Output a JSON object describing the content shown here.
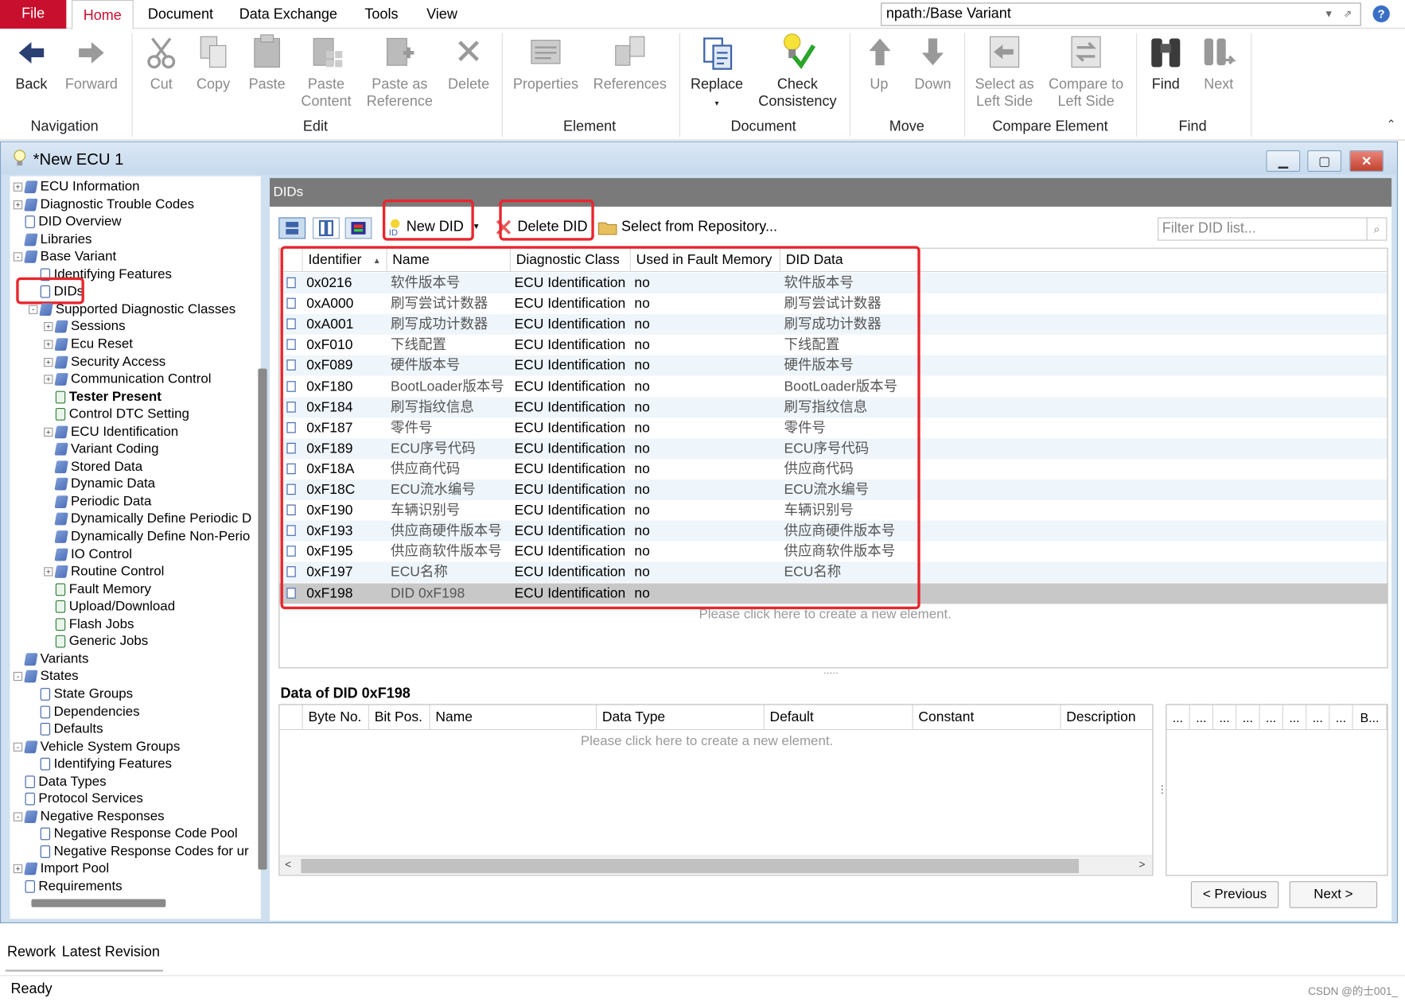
{
  "menu": {
    "file": "File",
    "tabs": [
      "Home",
      "Document",
      "Data Exchange",
      "Tools",
      "View"
    ],
    "npath": "npath:/Base Variant"
  },
  "ribbon": {
    "back": "Back",
    "forward": "Forward",
    "navigation": "Navigation",
    "cut": "Cut",
    "copy": "Copy",
    "paste": "Paste",
    "paste_content": [
      "Paste",
      "Content"
    ],
    "paste_reference": [
      "Paste as",
      "Reference"
    ],
    "delete": "Delete",
    "edit": "Edit",
    "properties": "Properties",
    "references": "References",
    "element": "Element",
    "replace": "Replace",
    "check_consistency": [
      "Check",
      "Consistency"
    ],
    "document": "Document",
    "up": "Up",
    "down": "Down",
    "move": "Move",
    "select_left": [
      "Select as",
      "Left Side"
    ],
    "compare_left": [
      "Compare to",
      "Left Side"
    ],
    "compare_element": "Compare Element",
    "find": "Find",
    "next": "Next",
    "find_group": "Find"
  },
  "doc": {
    "title": "*New ECU 1"
  },
  "tree": [
    {
      "label": "ECU Information",
      "level": 0,
      "exp": "+",
      "icon": "folder"
    },
    {
      "label": "Diagnostic Trouble Codes",
      "level": 0,
      "exp": "+",
      "icon": "folder"
    },
    {
      "label": "DID Overview",
      "level": 0,
      "exp": "",
      "icon": "page"
    },
    {
      "label": "Libraries",
      "level": 0,
      "exp": "",
      "icon": "folder"
    },
    {
      "label": "Base Variant",
      "level": 0,
      "exp": "-",
      "icon": "folder"
    },
    {
      "label": "Identifying Features",
      "level": 1,
      "exp": "",
      "icon": "page"
    },
    {
      "label": "DIDs",
      "level": 1,
      "exp": "",
      "icon": "page"
    },
    {
      "label": "Supported Diagnostic Classes",
      "level": 1,
      "exp": "-",
      "icon": "folder"
    },
    {
      "label": "Sessions",
      "level": 2,
      "exp": "+",
      "icon": "folder"
    },
    {
      "label": "Ecu Reset",
      "level": 2,
      "exp": "+",
      "icon": "folder"
    },
    {
      "label": "Security Access",
      "level": 2,
      "exp": "+",
      "icon": "folder"
    },
    {
      "label": "Communication Control",
      "level": 2,
      "exp": "+",
      "icon": "folder"
    },
    {
      "label": "Tester Present",
      "level": 2,
      "exp": "",
      "icon": "pageg",
      "bold": true
    },
    {
      "label": "Control DTC Setting",
      "level": 2,
      "exp": "",
      "icon": "pageg"
    },
    {
      "label": "ECU Identification",
      "level": 2,
      "exp": "+",
      "icon": "folder"
    },
    {
      "label": "Variant Coding",
      "level": 2,
      "exp": "",
      "icon": "folder"
    },
    {
      "label": "Stored Data",
      "level": 2,
      "exp": "",
      "icon": "folder"
    },
    {
      "label": "Dynamic Data",
      "level": 2,
      "exp": "",
      "icon": "folder"
    },
    {
      "label": "Periodic Data",
      "level": 2,
      "exp": "",
      "icon": "folder"
    },
    {
      "label": "Dynamically Define Periodic D",
      "level": 2,
      "exp": "",
      "icon": "folder"
    },
    {
      "label": "Dynamically Define Non-Perio",
      "level": 2,
      "exp": "",
      "icon": "folder"
    },
    {
      "label": "IO Control",
      "level": 2,
      "exp": "",
      "icon": "folder"
    },
    {
      "label": "Routine Control",
      "level": 2,
      "exp": "+",
      "icon": "folder"
    },
    {
      "label": "Fault Memory",
      "level": 2,
      "exp": "",
      "icon": "pageg"
    },
    {
      "label": "Upload/Download",
      "level": 2,
      "exp": "",
      "icon": "pageg"
    },
    {
      "label": "Flash Jobs",
      "level": 2,
      "exp": "",
      "icon": "pageg"
    },
    {
      "label": "Generic Jobs",
      "level": 2,
      "exp": "",
      "icon": "pageg"
    },
    {
      "label": "Variants",
      "level": 0,
      "exp": "",
      "icon": "folder"
    },
    {
      "label": "States",
      "level": 0,
      "exp": "-",
      "icon": "folder"
    },
    {
      "label": "State Groups",
      "level": 1,
      "exp": "",
      "icon": "page"
    },
    {
      "label": "Dependencies",
      "level": 1,
      "exp": "",
      "icon": "page"
    },
    {
      "label": "Defaults",
      "level": 1,
      "exp": "",
      "icon": "page"
    },
    {
      "label": "Vehicle System Groups",
      "level": 0,
      "exp": "-",
      "icon": "folder"
    },
    {
      "label": "Identifying Features",
      "level": 1,
      "exp": "",
      "icon": "page"
    },
    {
      "label": "Data Types",
      "level": 0,
      "exp": "",
      "icon": "page"
    },
    {
      "label": "Protocol Services",
      "level": 0,
      "exp": "",
      "icon": "page"
    },
    {
      "label": "Negative Responses",
      "level": 0,
      "exp": "-",
      "icon": "folder"
    },
    {
      "label": "Negative Response Code Pool",
      "level": 1,
      "exp": "",
      "icon": "page"
    },
    {
      "label": "Negative Response Codes for ur",
      "level": 1,
      "exp": "",
      "icon": "page"
    },
    {
      "label": "Import Pool",
      "level": 0,
      "exp": "+",
      "icon": "folder"
    },
    {
      "label": "Requirements",
      "level": 0,
      "exp": "",
      "icon": "page"
    }
  ],
  "dids": {
    "header": "DIDs",
    "toolbar": {
      "new": "New DID",
      "delete": "Delete DID",
      "select_repo": "Select from Repository...",
      "filter_placeholder": "Filter DID list..."
    },
    "columns": [
      "Identifier",
      "Name",
      "Diagnostic Class",
      "Used in Fault Memory",
      "DID Data"
    ],
    "rows": [
      [
        "0x0216",
        "软件版本号",
        "ECU Identification",
        "no",
        "软件版本号"
      ],
      [
        "0xA000",
        "刷写尝试计数器",
        "ECU Identification",
        "no",
        "刷写尝试计数器"
      ],
      [
        "0xA001",
        "刷写成功计数器",
        "ECU Identification",
        "no",
        "刷写成功计数器"
      ],
      [
        "0xF010",
        "下线配置",
        "ECU Identification",
        "no",
        "下线配置"
      ],
      [
        "0xF089",
        "硬件版本号",
        "ECU Identification",
        "no",
        "硬件版本号"
      ],
      [
        "0xF180",
        "BootLoader版本号",
        "ECU Identification",
        "no",
        "BootLoader版本号"
      ],
      [
        "0xF184",
        "刷写指纹信息",
        "ECU Identification",
        "no",
        "刷写指纹信息"
      ],
      [
        "0xF187",
        "零件号",
        "ECU Identification",
        "no",
        "零件号"
      ],
      [
        "0xF189",
        "ECU序号代码",
        "ECU Identification",
        "no",
        "ECU序号代码"
      ],
      [
        "0xF18A",
        "供应商代码",
        "ECU Identification",
        "no",
        "供应商代码"
      ],
      [
        "0xF18C",
        "ECU流水编号",
        "ECU Identification",
        "no",
        " ECU流水编号"
      ],
      [
        "0xF190",
        "车辆识别号",
        "ECU Identification",
        "no",
        "车辆识别号"
      ],
      [
        "0xF193",
        "供应商硬件版本号",
        "ECU Identification",
        "no",
        "供应商硬件版本号"
      ],
      [
        "0xF195",
        "供应商软件版本号",
        "ECU Identification",
        "no",
        "供应商软件版本号"
      ],
      [
        "0xF197",
        "ECU名称",
        "ECU Identification",
        "no",
        "ECU名称"
      ],
      [
        "0xF198",
        "DID 0xF198",
        "ECU Identification",
        "no",
        ""
      ]
    ],
    "create_hint": "Please click here to create a new element."
  },
  "data_of": {
    "title": "Data of DID 0xF198",
    "columns": [
      "Byte No.",
      "Bit Pos.",
      "Name",
      "Data Type",
      "Default",
      "Constant",
      "Description"
    ],
    "side_columns": [
      "...",
      "...",
      "...",
      "...",
      "...",
      "...",
      "...",
      "...",
      "B..."
    ],
    "create_hint": "Please click here to create a new element."
  },
  "pager": {
    "previous": "< Previous",
    "next": "Next >"
  },
  "bottom_tabs": [
    "Rework",
    "Latest Revision"
  ],
  "status": "Ready",
  "watermark": "CSDN @的士001_",
  "colors": {
    "file_tab": "#c8102e",
    "highlight": "#e8262d",
    "header": "#7a7a7a"
  }
}
